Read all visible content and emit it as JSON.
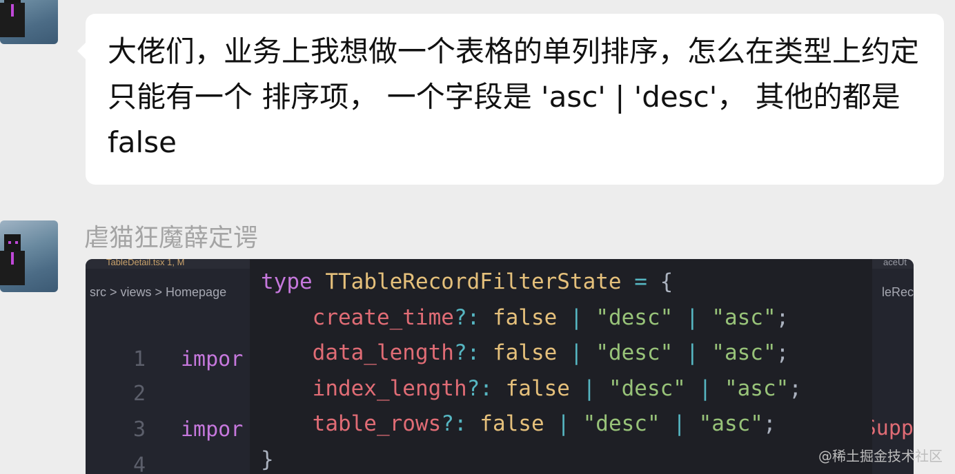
{
  "message_1": {
    "text": "大佬们，业务上我想做一个表格的单列排序，怎么在类型上约定只能有一个 排序项， 一个字段是 'asc' | 'desc'， 其他的都是 false"
  },
  "message_2": {
    "sender": "虐猫狂魔薛定谔",
    "screenshot": {
      "tab_label": "TableDetail.tsx 1, M",
      "tab_right": "aceUt",
      "breadcrumb": "src > views > Homepage",
      "breadcrumb_right": "leRec",
      "lines": [
        {
          "num": "1",
          "code": "impor"
        },
        {
          "num": "2",
          "code": ""
        },
        {
          "num": "3",
          "code": "impor"
        },
        {
          "num": "4",
          "code": ""
        }
      ],
      "code_right": "Supp",
      "type_decl": {
        "keyword": "type",
        "name": "TTableRecordFilterState",
        "fields": [
          "create_time",
          "data_length",
          "index_length",
          "table_rows"
        ],
        "value_false": "false",
        "value_desc": "\"desc\"",
        "value_asc": "\"asc\""
      }
    }
  },
  "watermark": "@稀土掘金技术社区"
}
